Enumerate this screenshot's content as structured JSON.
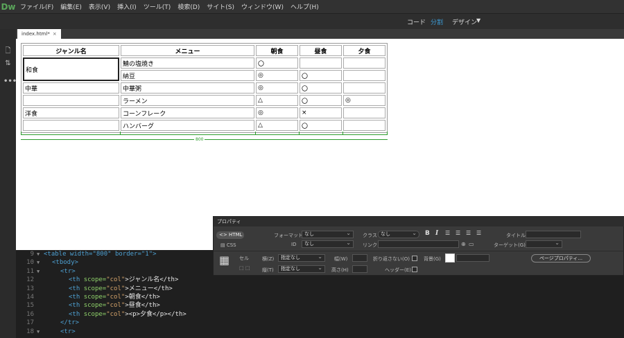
{
  "app": {
    "logo": "Dw"
  },
  "menu": [
    "ファイル(F)",
    "編集(E)",
    "表示(V)",
    "挿入(I)",
    "ツール(T)",
    "検索(D)",
    "サイト(S)",
    "ウィンドウ(W)",
    "ヘルプ(H)"
  ],
  "view_switcher": {
    "code": "コード",
    "split": "分割",
    "design": "デザイン",
    "active": "split"
  },
  "doc_tab": {
    "name": "index.html*",
    "close": "×"
  },
  "table": {
    "headers": [
      "ジャンル名",
      "メニュー",
      "朝食",
      "昼食",
      "夕食"
    ],
    "rows": [
      [
        "和食",
        "鯖の塩焼き",
        "〇",
        "",
        ""
      ],
      [
        "",
        "納豆",
        "◎",
        "〇",
        ""
      ],
      [
        "中華",
        "中華粥",
        "◎",
        "〇",
        ""
      ],
      [
        "",
        "ラーメン",
        "△",
        "〇",
        "◎"
      ],
      [
        "洋食",
        "コーンフレーク",
        "◎",
        "×",
        ""
      ],
      [
        "",
        "ハンバーグ",
        "△",
        "〇",
        ""
      ]
    ],
    "width_label": "800"
  },
  "code": [
    {
      "ln": "9",
      "text": "<table width=\"800\" border=\"1\">"
    },
    {
      "ln": "10",
      "text": "<tbody>"
    },
    {
      "ln": "11",
      "text": "<tr>"
    },
    {
      "ln": "12",
      "tag_open": "<th ",
      "attr": "scope=",
      "val": "\"col\"",
      "content": ">ジャンル名</th>"
    },
    {
      "ln": "13",
      "tag_open": "<th ",
      "attr": "scope=",
      "val": "\"col\"",
      "content": ">メニュー</th>"
    },
    {
      "ln": "14",
      "tag_open": "<th ",
      "attr": "scope=",
      "val": "\"col\"",
      "content": ">朝食</th>"
    },
    {
      "ln": "15",
      "tag_open": "<th ",
      "attr": "scope=",
      "val": "\"col\"",
      "content": ">昼食</th>"
    },
    {
      "ln": "16",
      "tag_open": "<th ",
      "attr": "scope=",
      "val": "\"col\"",
      "content": "><p>夕食</p></th>"
    },
    {
      "ln": "17",
      "text": "</tr>"
    },
    {
      "ln": "18",
      "text": "<tr>"
    }
  ],
  "properties": {
    "title": "プロパティ",
    "html_btn": "HTML",
    "css_btn": "CSS",
    "format_label": "フォーマット",
    "format_value": "なし",
    "class_label": "クラス",
    "class_value": "なし",
    "id_label": "ID",
    "id_value": "なし",
    "link_label": "リンク",
    "title_label": "タイトル",
    "target_label": "ターゲット(G)",
    "cell_label": "セル",
    "horz_label": "横(Z)",
    "horz_value": "指定なし",
    "vert_label": "縦(T)",
    "vert_value": "指定なし",
    "width_label": "幅(W)",
    "height_label": "高さ(H)",
    "nowrap_label": "折り返さない(O)",
    "header_label": "ヘッダー(E)",
    "bg_label": "背景(G)",
    "page_props": "ページプロパティ..."
  }
}
